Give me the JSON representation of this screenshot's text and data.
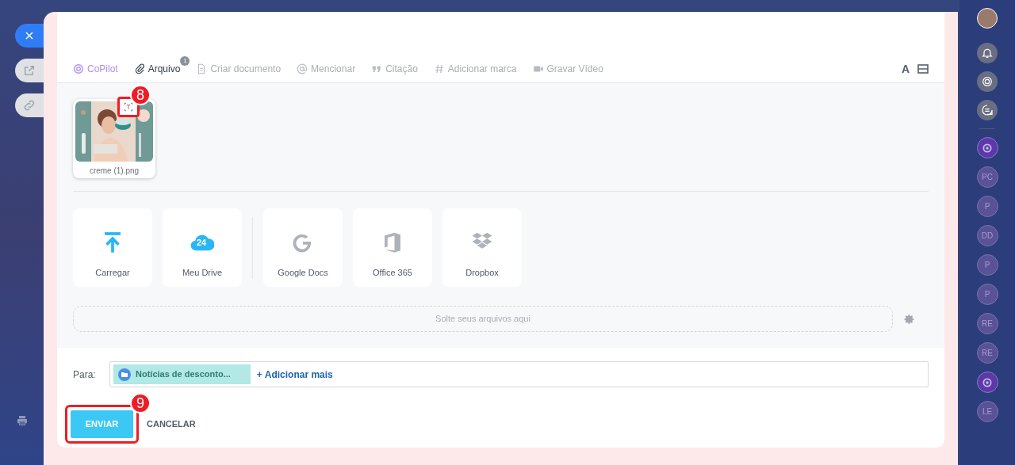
{
  "left_rail": [
    {
      "kind": "close",
      "selected": true
    },
    {
      "kind": "external",
      "selected": false
    },
    {
      "kind": "link",
      "selected": false
    }
  ],
  "toolbar": {
    "tabs": [
      {
        "kind": "copilot",
        "label": "CoPilot",
        "selected": false
      },
      {
        "kind": "clip",
        "label": "Arquivo",
        "selected": true,
        "count": "1"
      },
      {
        "kind": "doc",
        "label": "Criar documento",
        "selected": false
      },
      {
        "kind": "at",
        "label": "Mencionar",
        "selected": false
      },
      {
        "kind": "quote",
        "label": "Citação",
        "selected": false
      },
      {
        "kind": "hash",
        "label": "Adicionar marca",
        "selected": false
      },
      {
        "kind": "video",
        "label": "Gravar Vídeo",
        "selected": false
      }
    ],
    "font_button": "A"
  },
  "attachments": [
    {
      "kind": "picture",
      "filename": "creme (1)",
      "extension": ".png",
      "callout": "8"
    }
  ],
  "sources": [
    {
      "kind": "upload",
      "label": "Carregar"
    },
    {
      "kind": "drive",
      "label": "Meu Drive",
      "badge": "24"
    },
    {
      "kind": "google",
      "label": "Google Docs"
    },
    {
      "kind": "office",
      "label": "Office 365"
    },
    {
      "kind": "dropbox",
      "label": "Dropbox"
    }
  ],
  "dropzone": {
    "placeholder": "Solte seus arquivos aqui"
  },
  "recipients": {
    "label": "Para:",
    "chips": [
      {
        "label": "Notícias de desconto..."
      }
    ],
    "add_link": "+ Adicionar mais"
  },
  "actions": {
    "send": "ENVIAR",
    "send_callout": "9",
    "cancel": "CANCELAR"
  },
  "right_rail": [
    {
      "kind": "bell"
    },
    {
      "kind": "copilot"
    },
    {
      "kind": "chat"
    },
    {
      "kind": "copilot-chat"
    },
    {
      "kind": "initials",
      "text": "PC"
    },
    {
      "kind": "initials",
      "text": "P"
    },
    {
      "kind": "initials",
      "text": "DD"
    },
    {
      "kind": "initials",
      "text": "P"
    },
    {
      "kind": "initials",
      "text": "P"
    },
    {
      "kind": "initials",
      "text": "RE"
    },
    {
      "kind": "initials",
      "text": "RE"
    },
    {
      "kind": "copilot-chat"
    },
    {
      "kind": "initials",
      "text": "LE"
    }
  ]
}
